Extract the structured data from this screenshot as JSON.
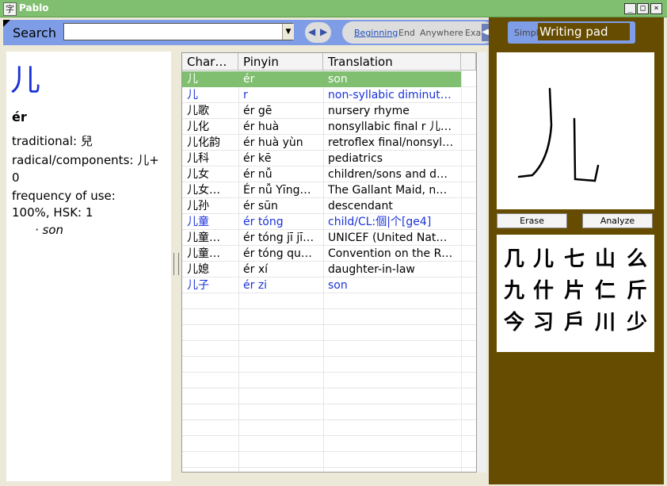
{
  "window": {
    "title": "Pablo",
    "app_icon_glyph": "字",
    "minimize": "_",
    "maximize": "□",
    "close": "×"
  },
  "search": {
    "label": "Search",
    "value": "",
    "dropdown_icon": "chevron-down-icon"
  },
  "nav": {
    "prev": "◀",
    "next": "▶"
  },
  "modes": {
    "items": [
      "Beginning",
      "End",
      "Anywhere",
      "Exa"
    ],
    "active": "Beginning",
    "more": "◀▶"
  },
  "pad_header": {
    "simpl": "Simpl",
    "label": "Writing pad"
  },
  "detail": {
    "char": "儿",
    "pinyin": "ér",
    "traditional": "traditional: 兒",
    "radical_1": "radical/components: 儿+",
    "radical_2": "0",
    "frequency_1": "frequency of use:",
    "frequency_2": "100%, HSK: 1",
    "meaning": "· son"
  },
  "table": {
    "headers": [
      "Char…",
      "Pinyin",
      "Translation"
    ],
    "rows": [
      {
        "char": "儿",
        "pinyin": "ér",
        "translation": "son",
        "color": "#ffffff",
        "selected": true
      },
      {
        "char": "儿",
        "pinyin": "r",
        "translation": "non-syllabic diminut…",
        "color": "#1a32d8"
      },
      {
        "char": "儿歌",
        "pinyin": "ér gē",
        "translation": "nursery rhyme",
        "color": "#000000"
      },
      {
        "char": "儿化",
        "pinyin": "ér huà",
        "translation": "nonsyllabic final r 儿…",
        "color": "#000000"
      },
      {
        "char": "儿化韵",
        "pinyin": "ér huà yùn",
        "translation": "retroflex final/nonsyl…",
        "color": "#000000"
      },
      {
        "char": "儿科",
        "pinyin": "ér kē",
        "translation": "pediatrics",
        "color": "#000000"
      },
      {
        "char": "儿女",
        "pinyin": "ér nǚ",
        "translation": "children/sons and d…",
        "color": "#000000"
      },
      {
        "char": "儿女…",
        "pinyin": "Ér nǚ Yīng…",
        "translation": "The Gallant Maid, n…",
        "color": "#000000"
      },
      {
        "char": "儿孙",
        "pinyin": "ér sūn",
        "translation": "descendant",
        "color": "#000000"
      },
      {
        "char": "儿童",
        "pinyin": "ér tóng",
        "translation": "child/CL:個|个[ge4]",
        "color": "#1a32d8"
      },
      {
        "char": "儿童…",
        "pinyin": "ér tóng jī jī…",
        "translation": "UNICEF (United Nat…",
        "color": "#000000"
      },
      {
        "char": "儿童…",
        "pinyin": "ér tóng qu…",
        "translation": "Convention on the R…",
        "color": "#000000"
      },
      {
        "char": "儿媳",
        "pinyin": "ér xí",
        "translation": "daughter-in-law",
        "color": "#000000"
      },
      {
        "char": "儿子",
        "pinyin": "ér zi",
        "translation": "son",
        "color": "#1a32d8"
      }
    ]
  },
  "buttons": {
    "erase": "Erase",
    "analyze": "Analyze"
  },
  "candidates": [
    "几",
    "儿",
    "七",
    "山",
    "么",
    "九",
    "什",
    "片",
    "仁",
    "斤",
    "今",
    "习",
    "戶",
    "川",
    "少"
  ]
}
